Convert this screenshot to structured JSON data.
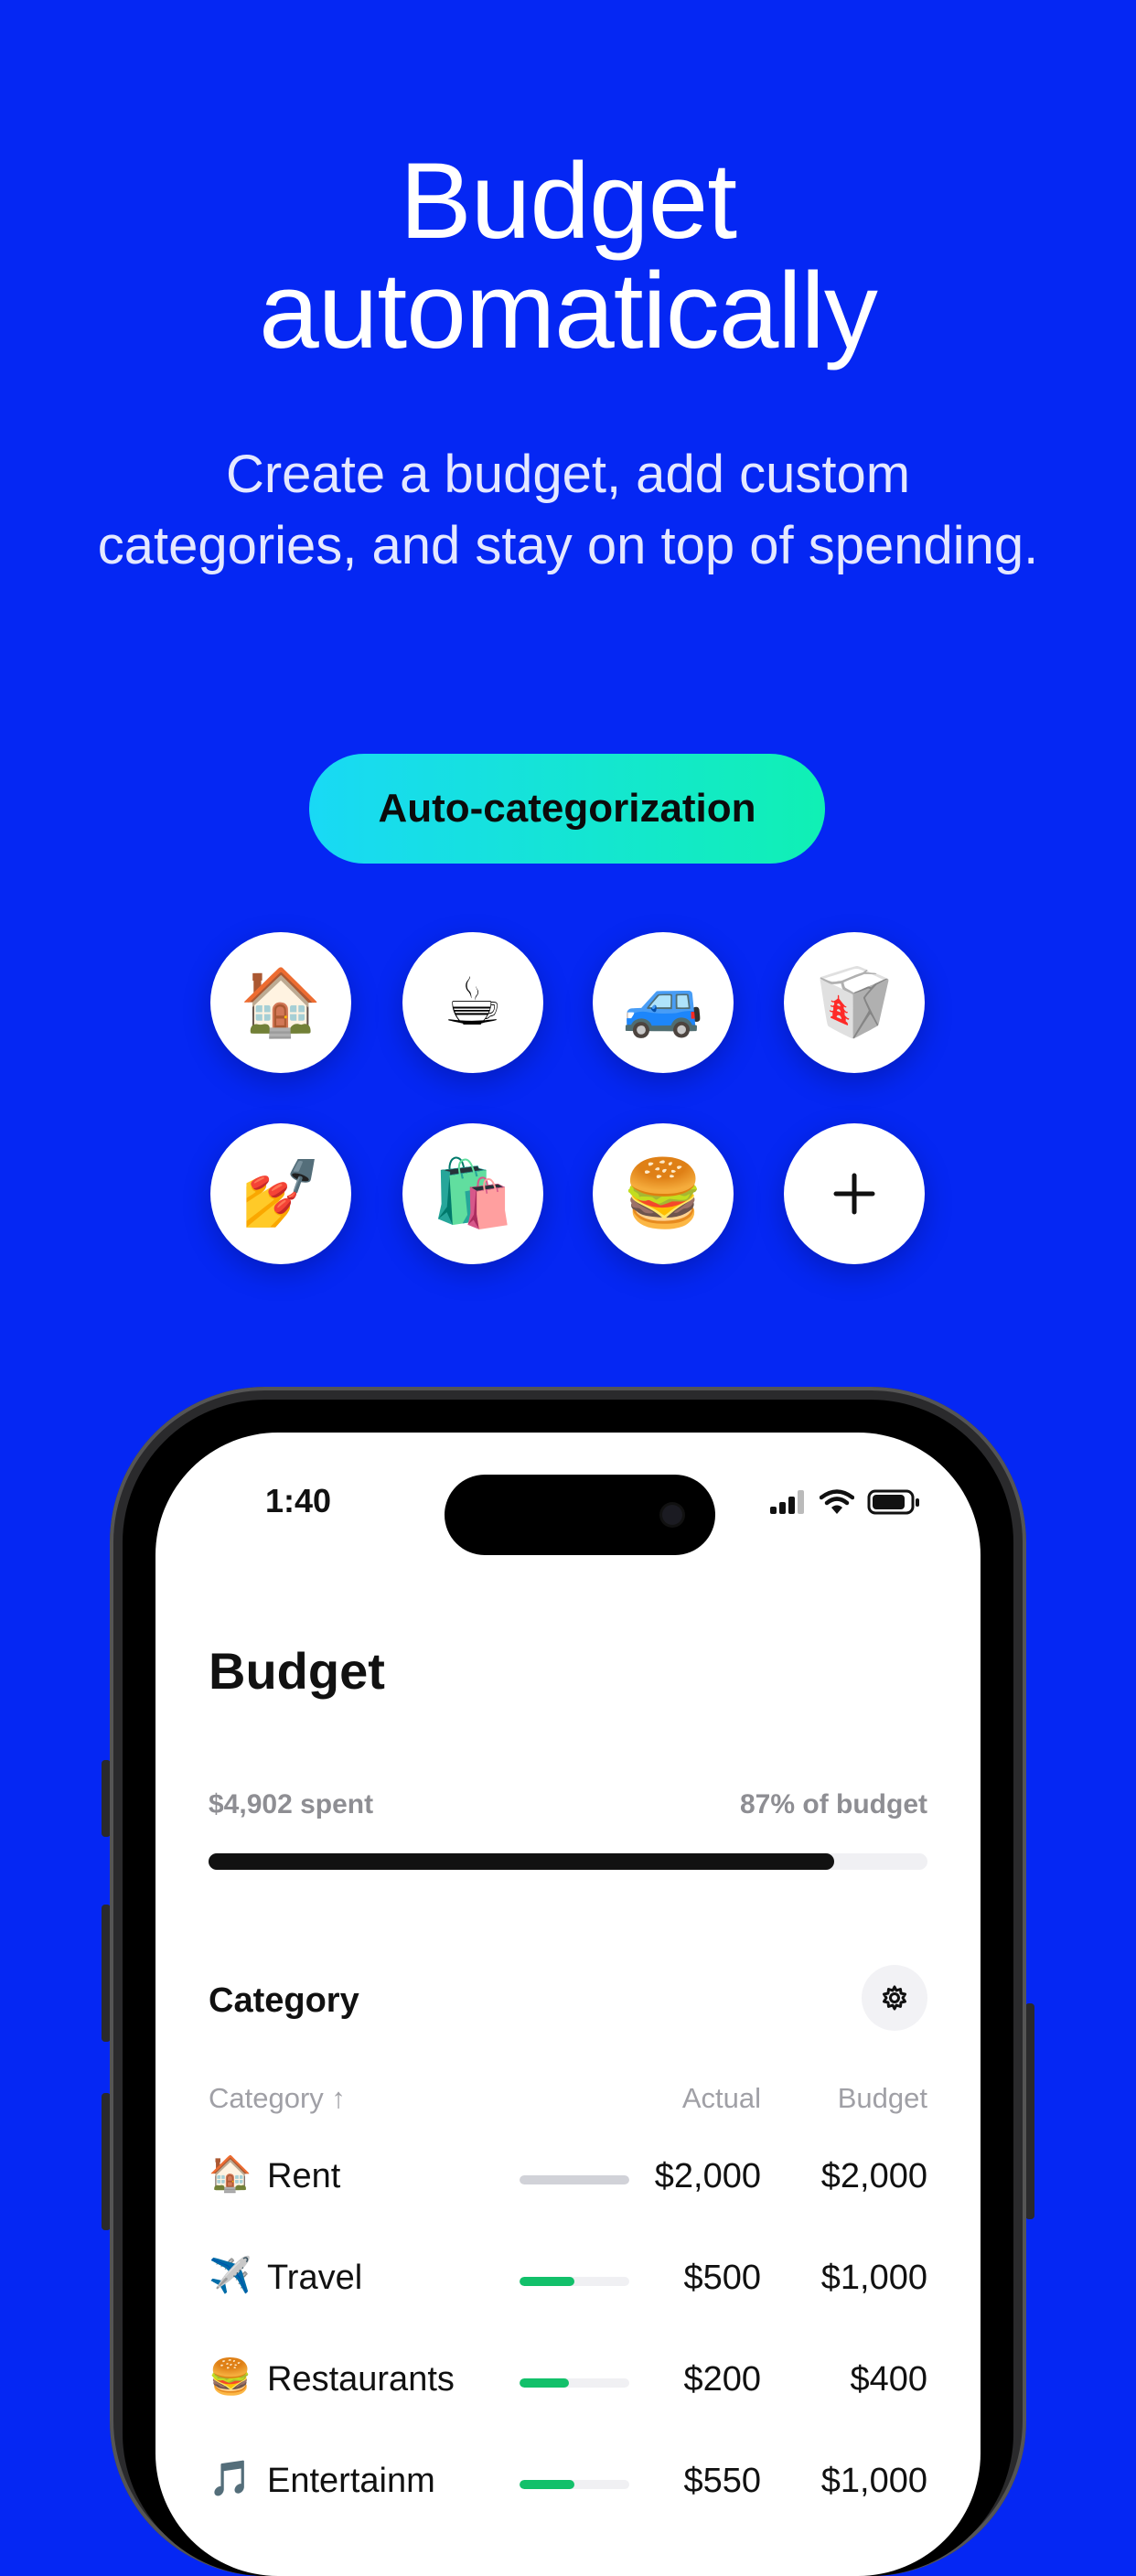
{
  "hero": {
    "headline_line1": "Budget",
    "headline_line2": "automatically",
    "subtitle_line1": "Create a budget, add custom",
    "subtitle_line2": "categories, and stay on top of spending."
  },
  "feature_pill": {
    "label": "Auto-categorization"
  },
  "category_chips": [
    {
      "icon": "house-icon",
      "glyph": "🏠"
    },
    {
      "icon": "coffee-icon",
      "glyph": "☕"
    },
    {
      "icon": "car-icon",
      "glyph": "🚙"
    },
    {
      "icon": "takeout-box-icon",
      "glyph": "🥡"
    },
    {
      "icon": "nail-polish-icon",
      "glyph": "💅"
    },
    {
      "icon": "shopping-bags-icon",
      "glyph": "🛍️"
    },
    {
      "icon": "burger-icon",
      "glyph": "🍔"
    },
    {
      "icon": "plus-icon",
      "glyph": "+"
    }
  ],
  "phone": {
    "status_time": "1:40",
    "screen_title": "Budget",
    "spent": "$4,902 spent",
    "percent_of_budget": "87% of budget",
    "progress": 0.87,
    "category_heading": "Category",
    "columns": {
      "category": "Category ↑",
      "actual": "Actual",
      "budget": "Budget"
    },
    "rows": [
      {
        "emoji": "🏠",
        "icon": "house-icon",
        "name": "Rent",
        "actual": "$2,000",
        "budget": "$2,000",
        "progress": 1.0,
        "bar_color": "#D1D2D8"
      },
      {
        "emoji": "✈️",
        "icon": "airplane-icon",
        "name": "Travel",
        "actual": "$500",
        "budget": "$1,000",
        "progress": 0.5,
        "bar_color": "#12C06A"
      },
      {
        "emoji": "🍔",
        "icon": "burger-icon",
        "name": "Restaurants",
        "actual": "$200",
        "budget": "$400",
        "progress": 0.45,
        "bar_color": "#12C06A"
      },
      {
        "emoji": "🎵",
        "icon": "music-note-icon",
        "name": "Entertainm",
        "actual": "$550",
        "budget": "$1,000",
        "progress": 0.5,
        "bar_color": "#12C06A"
      }
    ]
  },
  "colors": {
    "background": "#0527F3",
    "pill_start": "#19D9F5",
    "pill_end": "#10F0B4",
    "progress": "#111111",
    "green": "#12C06A"
  }
}
